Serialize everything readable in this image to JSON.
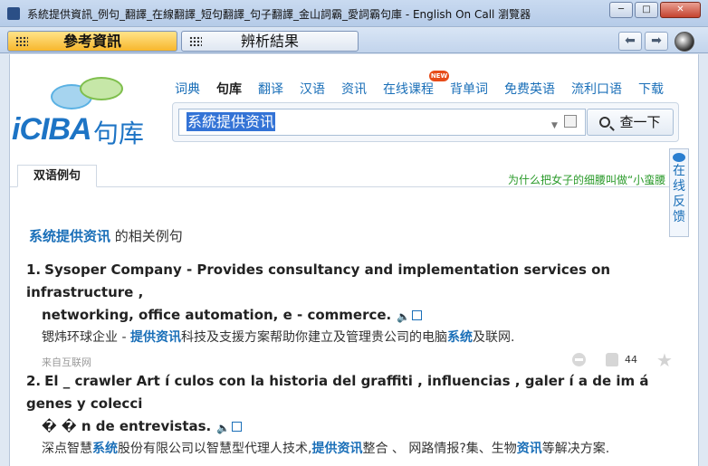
{
  "window": {
    "title": "系統提供資訊_例句_翻譯_在線翻譯_短句翻譯_句子翻譯_金山詞霸_愛詞霸句庫 - English On Call 瀏覽器",
    "minimize": "─",
    "maximize": "□",
    "close": "✕"
  },
  "toolbar": {
    "tab_reference": "參考資訊",
    "tab_analysis": "辨析結果",
    "back": "⬅",
    "forward": "➡"
  },
  "logo": {
    "brand": "iCIBA",
    "suffix": "句库"
  },
  "nav": {
    "items": [
      "词典",
      "句库",
      "翻译",
      "汉语",
      "资讯",
      "在线课程",
      "背单词",
      "免费英语",
      "流利口语",
      "下载"
    ],
    "new_badge": "NEW"
  },
  "search": {
    "value": "系統提供资讯",
    "button": "查一下"
  },
  "tabs": {
    "bilingual": "双语例句"
  },
  "promo": "为什么把女子的细腰叫做“小蛮腰",
  "feedback": {
    "label": [
      "在",
      "线",
      "反",
      "馈"
    ]
  },
  "section": {
    "keyword": "系统提供资讯",
    "suffix": " 的相关例句"
  },
  "examples": [
    {
      "num": "1.",
      "en_line1": "Sysoper Company - Provides consultancy and implementation services on infrastructure ,",
      "en_line2": "networking, office automation, e - commerce.",
      "zh_parts": [
        {
          "t": "锶炜环球企业 - ",
          "hl": false
        },
        {
          "t": "提供资讯",
          "hl": true
        },
        {
          "t": "科技及支援方案帮助你建立及管理贵公司的电脑",
          "hl": false
        },
        {
          "t": "系统",
          "hl": true
        },
        {
          "t": "及联网.",
          "hl": false
        }
      ],
      "source": "来自互联网",
      "likes": "44"
    },
    {
      "num": "2.",
      "en_line1": "El _ crawler Art í culos con la historia del graffiti , influencias , galer í a de im á genes y colecci",
      "en_line2": "� � n de entrevistas.",
      "zh_parts": [
        {
          "t": "深点智慧",
          "hl": false
        },
        {
          "t": "系统",
          "hl": true
        },
        {
          "t": "股份有限公司以智慧型代理人技术,",
          "hl": false
        },
        {
          "t": "提供资讯",
          "hl": true
        },
        {
          "t": "整合 、 网路情报?集、生物",
          "hl": false
        },
        {
          "t": "资讯",
          "hl": true
        },
        {
          "t": "等解决方案.",
          "hl": false
        }
      ]
    }
  ]
}
